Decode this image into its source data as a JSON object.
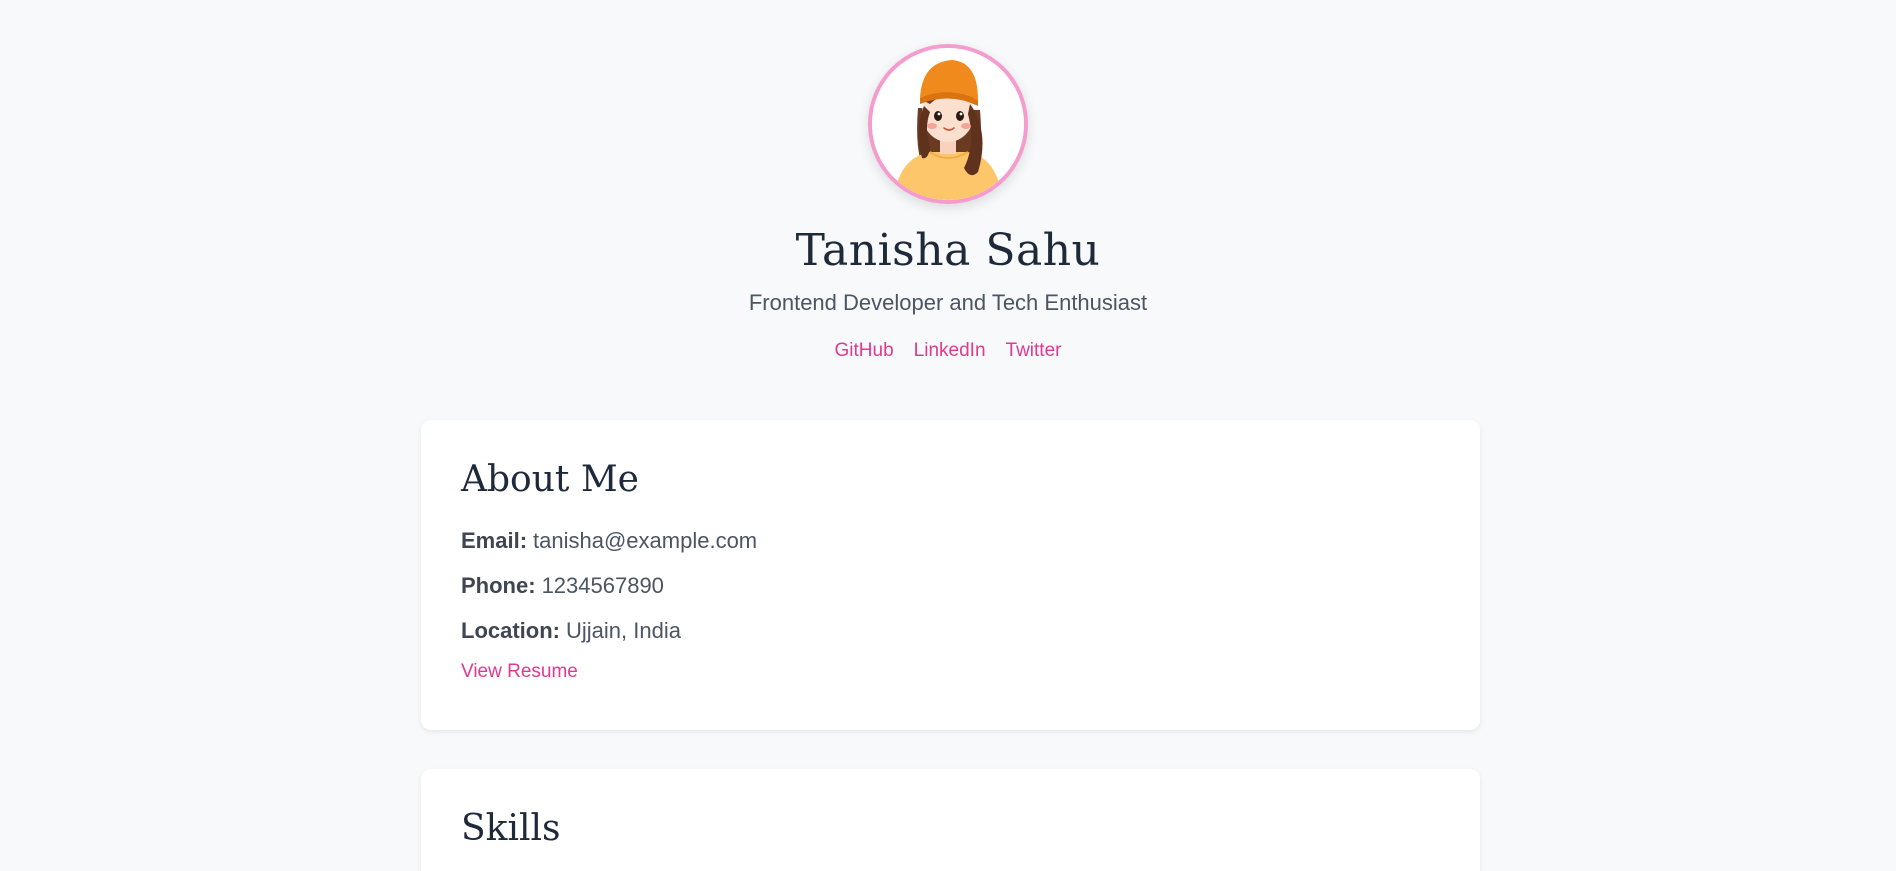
{
  "profile": {
    "name": "Tanisha Sahu",
    "tagline": "Frontend Developer and Tech Enthusiast",
    "avatar_icon": "avatar-illustration",
    "social_links": [
      "GitHub",
      "LinkedIn",
      "Twitter"
    ]
  },
  "about": {
    "title": "About Me",
    "email_label": "Email:",
    "email_value": "tanisha@example.com",
    "phone_label": "Phone:",
    "phone_value": "1234567890",
    "location_label": "Location:",
    "location_value": "Ujjain, India",
    "resume_link": "View Resume"
  },
  "skills": {
    "title": "Skills"
  },
  "colors": {
    "accent": "#e0398f",
    "avatar_border": "#f59ccf",
    "background": "#f8f9fb",
    "heading": "#1e2a3a"
  }
}
